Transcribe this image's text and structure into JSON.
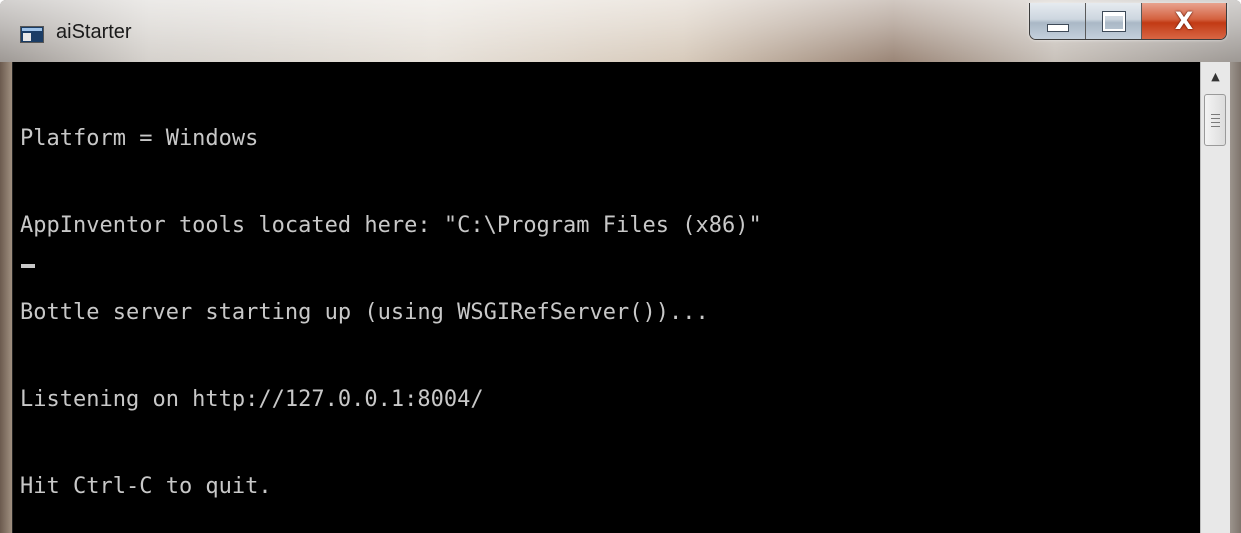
{
  "window": {
    "title": "aiStarter",
    "controls": {
      "minimize_icon": "minimize-icon",
      "maximize_icon": "maximize-icon",
      "close_glyph": "X"
    }
  },
  "console": {
    "text_color": "#c8c8c8",
    "background": "#000000",
    "lines": [
      "Platform = Windows",
      "AppInventor tools located here: \"C:\\Program Files (x86)\"",
      "Bottle server starting up (using WSGIRefServer())...",
      "Listening on http://127.0.0.1:8004/",
      "Hit Ctrl-C to quit."
    ]
  },
  "scrollbar": {
    "up_arrow": "▲"
  }
}
